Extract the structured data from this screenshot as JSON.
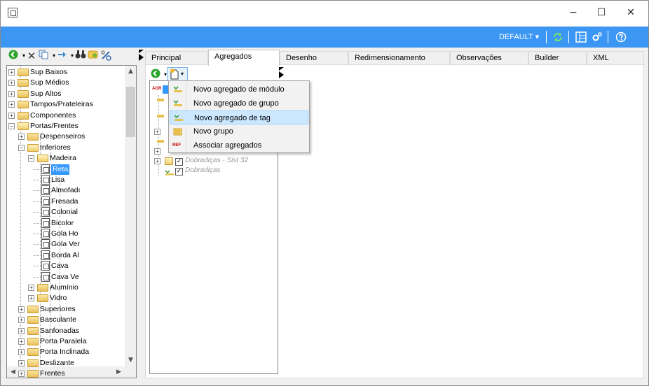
{
  "window": {
    "minimize": "−",
    "maximize": "☐",
    "close": "✕"
  },
  "blue_toolbar": {
    "profile": "DEFAULT",
    "profile_arrow": "▾",
    "icons": [
      "refresh-icon",
      "layout-icon",
      "settings-icon",
      "help-icon"
    ],
    "bg_color": "#3c97f4"
  },
  "left_toolbar": {
    "icons": [
      "go-icon",
      "delete-icon",
      "copy-icon",
      "move-icon",
      "binoculars-icon",
      "replace-icon",
      "tools-icon"
    ]
  },
  "tree": {
    "items": [
      {
        "label": "Sup Baixos"
      },
      {
        "label": "Sup Médios"
      },
      {
        "label": "Sup Altos"
      },
      {
        "label": "Tampos/Prateleiras"
      },
      {
        "label": "Componentes"
      },
      {
        "label": "Portas/Frentes"
      },
      {
        "label": "Despenseiros"
      },
      {
        "label": "Inferiores"
      },
      {
        "label": "Madeira"
      },
      {
        "label": "Reta"
      },
      {
        "label": "Lisa"
      },
      {
        "label": "Almofadı"
      },
      {
        "label": "Fresada"
      },
      {
        "label": "Colonial"
      },
      {
        "label": "Bicolor"
      },
      {
        "label": "Gola Ho"
      },
      {
        "label": "Gola Ver"
      },
      {
        "label": "Borda Al"
      },
      {
        "label": "Cava"
      },
      {
        "label": "Cava Ve"
      },
      {
        "label": "Alumínio"
      },
      {
        "label": "Vidro"
      },
      {
        "label": "Superiores"
      },
      {
        "label": "Basculante"
      },
      {
        "label": "Sanfonadas"
      },
      {
        "label": "Porta Paralela"
      },
      {
        "label": "Porta Inclinada"
      },
      {
        "label": "Deslizante"
      },
      {
        "label": "Frentes"
      }
    ],
    "selected": "Reta"
  },
  "tabs": [
    {
      "label": "Principal"
    },
    {
      "label": "Agregados"
    },
    {
      "label": "Desenho"
    },
    {
      "label": "Redimensionamento"
    },
    {
      "label": "Observações"
    },
    {
      "label": "Builder"
    },
    {
      "label": "XML"
    }
  ],
  "active_tab": "Agregados",
  "inner_tree": {
    "items": [
      {
        "label": "Dobradiças - Sist 32"
      },
      {
        "label": "Dobradiças"
      }
    ],
    "root_badge": "AGR"
  },
  "context_menu": {
    "items": [
      {
        "label": "Novo agregado de módulo",
        "icon": "aggregate-module-icon"
      },
      {
        "label": "Novo agregado de grupo",
        "icon": "aggregate-group-icon"
      },
      {
        "label": "Novo agregado de tag",
        "icon": "aggregate-tag-icon"
      },
      {
        "label": "Novo grupo",
        "icon": "folder-group-icon"
      },
      {
        "label": "Associar agregados",
        "icon": "ref-icon",
        "badge": "REF"
      }
    ],
    "highlighted": "Novo agregado de tag"
  }
}
